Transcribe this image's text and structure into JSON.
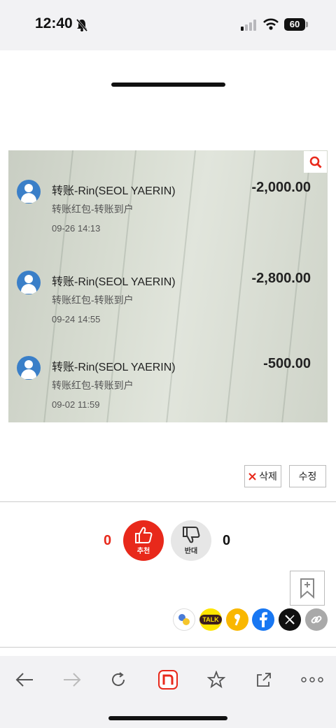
{
  "status_bar": {
    "time": "12:40",
    "battery": "60"
  },
  "photo": {
    "transactions": [
      {
        "name": "转账-Rin(SEOL YAERIN)",
        "memo": "转账红包-转账到户",
        "date": "09-26 14:13",
        "amount": "-2,000.00"
      },
      {
        "name": "转账-Rin(SEOL YAERIN)",
        "memo": "转账红包-转账到户",
        "date": "09-24 14:55",
        "amount": "-2,800.00"
      },
      {
        "name": "转账-Rin(SEOL YAERIN)",
        "memo": "转账红包-转账到户",
        "date": "09-02 11:59",
        "amount": "-500.00"
      }
    ]
  },
  "post_actions": {
    "delete_label": "삭제",
    "edit_label": "수정"
  },
  "votes": {
    "up_count": "0",
    "up_label": "추천",
    "down_label": "반대",
    "down_count": "0"
  },
  "colors": {
    "accent": "#e8291b",
    "kakao": "#fee500",
    "facebook": "#1877f2"
  },
  "share": [
    "band-icon",
    "kakaotalk-icon",
    "kakaostory-icon",
    "facebook-icon",
    "x-icon",
    "link-icon"
  ],
  "share_labels": {
    "kakaotalk": "TALK"
  },
  "toolbar": [
    "back-icon",
    "forward-icon",
    "reload-icon",
    "naver-icon",
    "bookmark-star-icon",
    "share-icon",
    "more-icon"
  ]
}
